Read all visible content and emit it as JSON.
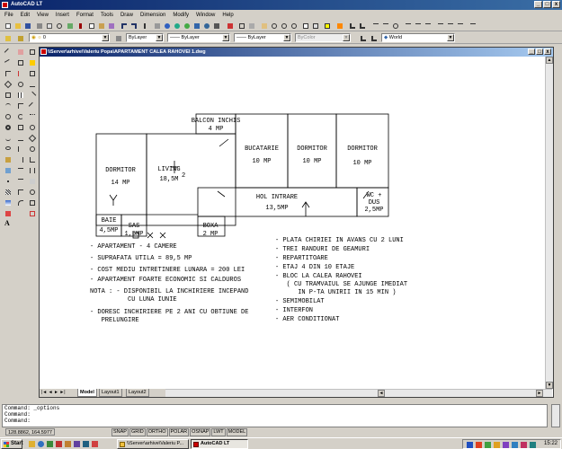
{
  "window": {
    "title": "AutoCAD LT",
    "icon": "autocad-icon",
    "controls": [
      "_",
      "□",
      "x"
    ]
  },
  "menu": [
    "File",
    "Edit",
    "View",
    "Insert",
    "Format",
    "Tools",
    "Draw",
    "Dimension",
    "Modify",
    "Window",
    "Help"
  ],
  "toolbar": {
    "layer_value": "0",
    "color_value": "ByLayer",
    "linetype_value": "ByLayer",
    "lineweight_value": "ByLayer",
    "plotstyle_value": "ByColor",
    "ucs_value": "World"
  },
  "drawing": {
    "title": "\\\\Server\\arhive\\Valeriu Popa\\APARTAMENT CALEA RAHOVEI 1.dwg",
    "rooms": {
      "balcon_label": "BALCON INCHIS",
      "balcon_area": "4 MP",
      "bucatarie_label": "BUCATARIE",
      "bucatarie_area": "10 MP",
      "dormitor2_label": "DORMITOR",
      "dormitor2_area": "10 MP",
      "dormitor3_label": "DORMITOR",
      "dormitor3_area": "10 MP",
      "dormitor1_label": "DORMITOR",
      "dormitor1_area": "14 MP",
      "living_label": "LIVING",
      "living_area": "18,5M",
      "living_area_sup": "2",
      "hol_label": "HOL INTRARE",
      "hol_area": "13,5MP",
      "wc_label": "WC +",
      "wc_label2": "DUS",
      "wc_area": "2,5MP",
      "baie_label": "BAIE",
      "baie_area": "4,5MP",
      "sas_label": "SAS",
      "sas_area": "1,5MP",
      "boxa_label": "BOXA",
      "boxa_area": "2 MP"
    },
    "notes_left": [
      "- APARTAMENT - 4 CAMERE",
      "- SUPRAFATA UTILA = 89,5 MP",
      "- COST MEDIU INTRETINERE LUNARA = 200 LEI",
      "- APARTAMENT FOARTE ECONOMIC SI CALDUROS",
      "NOTA : - DISPONIBIL LA INCHIRIERE INCEPAND",
      "          CU LUNA IUNIE",
      "- DORESC INCHIRIERE PE 2 ANI CU OBTIUNE DE",
      "   PRELUNGIRE"
    ],
    "notes_right": [
      "- PLATA CHIRIEI IN AVANS CU 2 LUNI",
      "- TREI RANDURI DE GEAMURI",
      "- REPARTITOARE",
      "- ETAJ 4 DIN 10 ETAJE",
      "- BLOC LA CALEA RAHOVEI",
      "   ( CU TRAMVAIUL SE AJUNGE IMEDIAT",
      "      IN P-TA UNIRII IN 15 MIN )",
      "- SEMIMOBILAT",
      "- INTERFON",
      "- AER CONDITIONAT"
    ],
    "tabs": [
      "Model",
      "Layout1",
      "Layout2"
    ],
    "active_tab": "Model"
  },
  "command": {
    "line1": "Command: _options",
    "line2": "Command:",
    "line3": "Command:"
  },
  "status": {
    "coords": "128.8862, 164.5977",
    "modes": [
      "SNAP",
      "GRID",
      "ORTHO",
      "POLAR",
      "OSNAP",
      "LWT",
      "MODEL"
    ]
  },
  "taskbar": {
    "start_label": "Start",
    "tasks": [
      "\\\\Server\\arhive\\Valeriu P...",
      "AutoCAD LT"
    ],
    "active_task": "AutoCAD LT",
    "clock": "15:22"
  },
  "colors": {
    "titlebar": "#0a246a",
    "accent": "#3a6ea5"
  }
}
